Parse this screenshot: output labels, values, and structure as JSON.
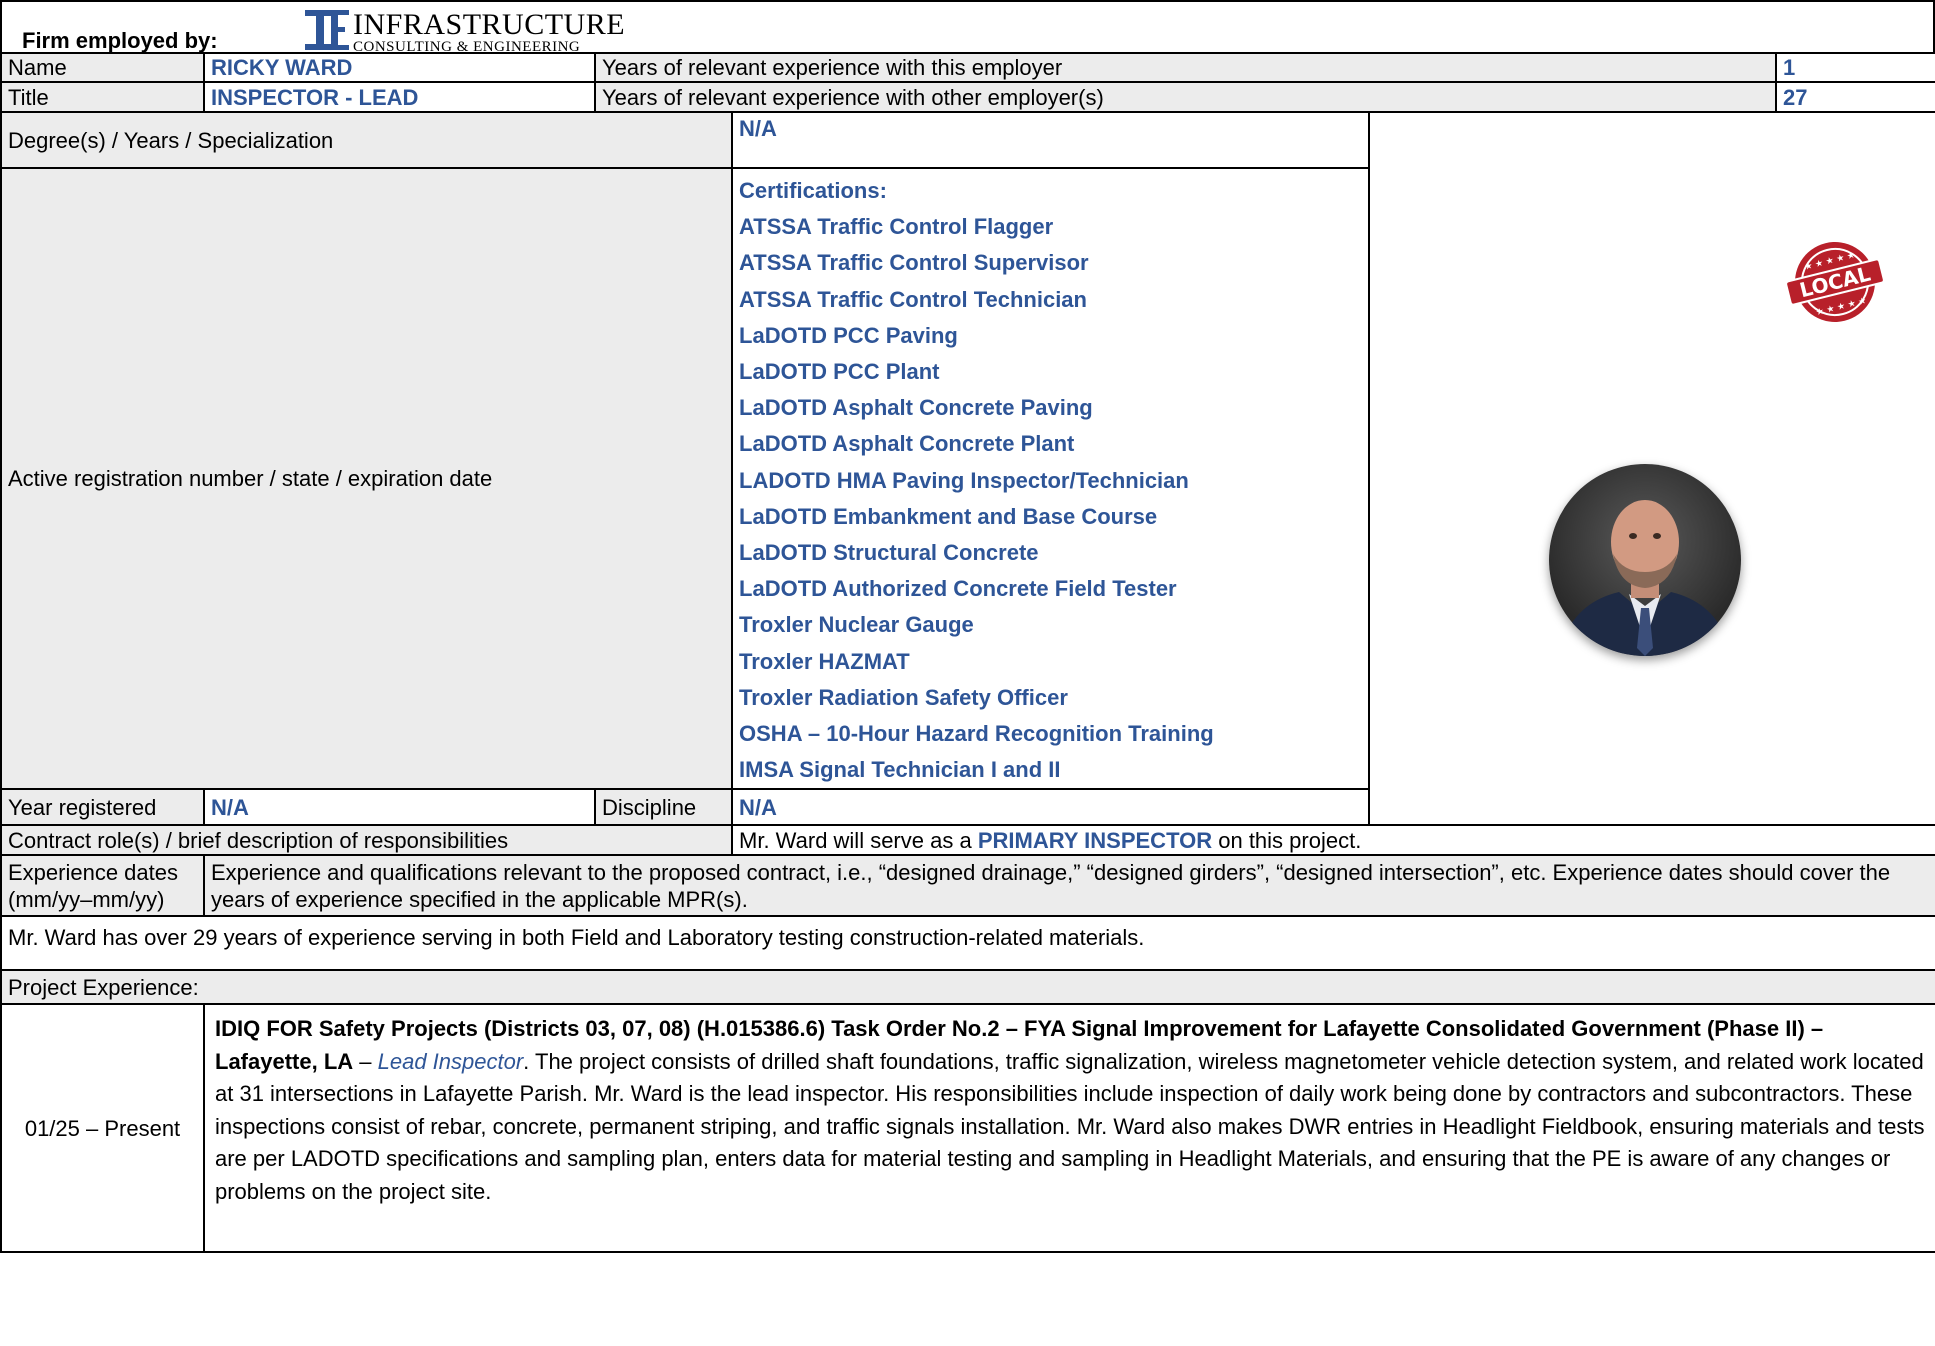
{
  "header": {
    "firm_label": "Firm employed by:",
    "logo_name": "INFRASTRUCTURE",
    "logo_sub": "CONSULTING & ENGINEERING"
  },
  "name_row": {
    "label": "Name",
    "value": "RICKY WARD",
    "exp_label": "Years of relevant experience with this employer",
    "exp_value": "1"
  },
  "title_row": {
    "label": "Title",
    "value": "INSPECTOR - LEAD",
    "exp_label": "Years of relevant experience with other employer(s)",
    "exp_value": "27"
  },
  "degree": {
    "label": "Degree(s) / Years / Specialization",
    "value": "N/A"
  },
  "registration": {
    "label": "Active registration number / state / expiration date",
    "certs_heading": "Certifications:",
    "certs": [
      "ATSSA Traffic Control Flagger",
      "ATSSA Traffic Control Supervisor",
      "ATSSA Traffic Control Technician",
      "LaDOTD PCC Paving",
      "LaDOTD PCC Plant",
      "LaDOTD Asphalt Concrete Paving",
      "LaDOTD Asphalt Concrete Plant",
      "LADOTD HMA Paving Inspector/Technician",
      "LaDOTD Embankment and Base Course",
      "LaDOTD Structural Concrete",
      "LaDOTD Authorized Concrete Field Tester",
      "Troxler Nuclear Gauge",
      "Troxler HAZMAT",
      "Troxler Radiation Safety Officer",
      "OSHA – 10-Hour Hazard Recognition Training",
      "IMSA Signal Technician I and II"
    ]
  },
  "badge": {
    "text": "LOCAL"
  },
  "year_registered": {
    "label": "Year registered",
    "value": "N/A",
    "discipline_label": "Discipline",
    "discipline_value": "N/A"
  },
  "contract_role": {
    "label": "Contract role(s) / brief description of responsibilities",
    "pre": "Mr. Ward will serve as a ",
    "role": "PRIMARY INSPECTOR",
    "post": " on this project."
  },
  "experience_dates": {
    "label1": "Experience dates",
    "label2": "(mm/yy–mm/yy)",
    "desc": "Experience and qualifications relevant to the proposed contract, i.e., “designed drainage,” “designed girders”, “designed intersection”, etc.  Experience dates should cover the years of experience specified in the applicable MPR(s)."
  },
  "summary": "Mr. Ward has over 29 years of experience serving in both Field and Laboratory testing construction-related materials.",
  "project_experience_label": "Project Experience:",
  "projects": [
    {
      "dates": "01/25 – Present",
      "title": "IDIQ FOR Safety Projects (Districts 03, 07, 08) (H.015386.6) Task Order No.2 – FYA Signal Improvement for Lafayette Consolidated Government (Phase II) – Lafayette, LA",
      "sep": " – ",
      "role": "Lead Inspector",
      "desc": ". The project consists of drilled shaft foundations, traffic signalization, wireless magnetometer vehicle detection system, and related work located at 31 intersections in Lafayette Parish.  Mr. Ward is the lead inspector. His responsibilities include inspection of daily work being done by contractors and subcontractors. These inspections consist of rebar, concrete, permanent striping, and traffic signals installation. Mr. Ward also makes DWR entries in Headlight Fieldbook, ensuring materials and tests are per LADOTD specifications and sampling plan, enters data for material testing and sampling in Headlight Materials, and ensuring that the PE is aware of any changes or problems on the project site."
    }
  ],
  "colors": {
    "label_bg": "#ececec",
    "value_blue": "#2e5597",
    "logo_blue": "#2e5597",
    "badge_red": "#b8202a"
  }
}
